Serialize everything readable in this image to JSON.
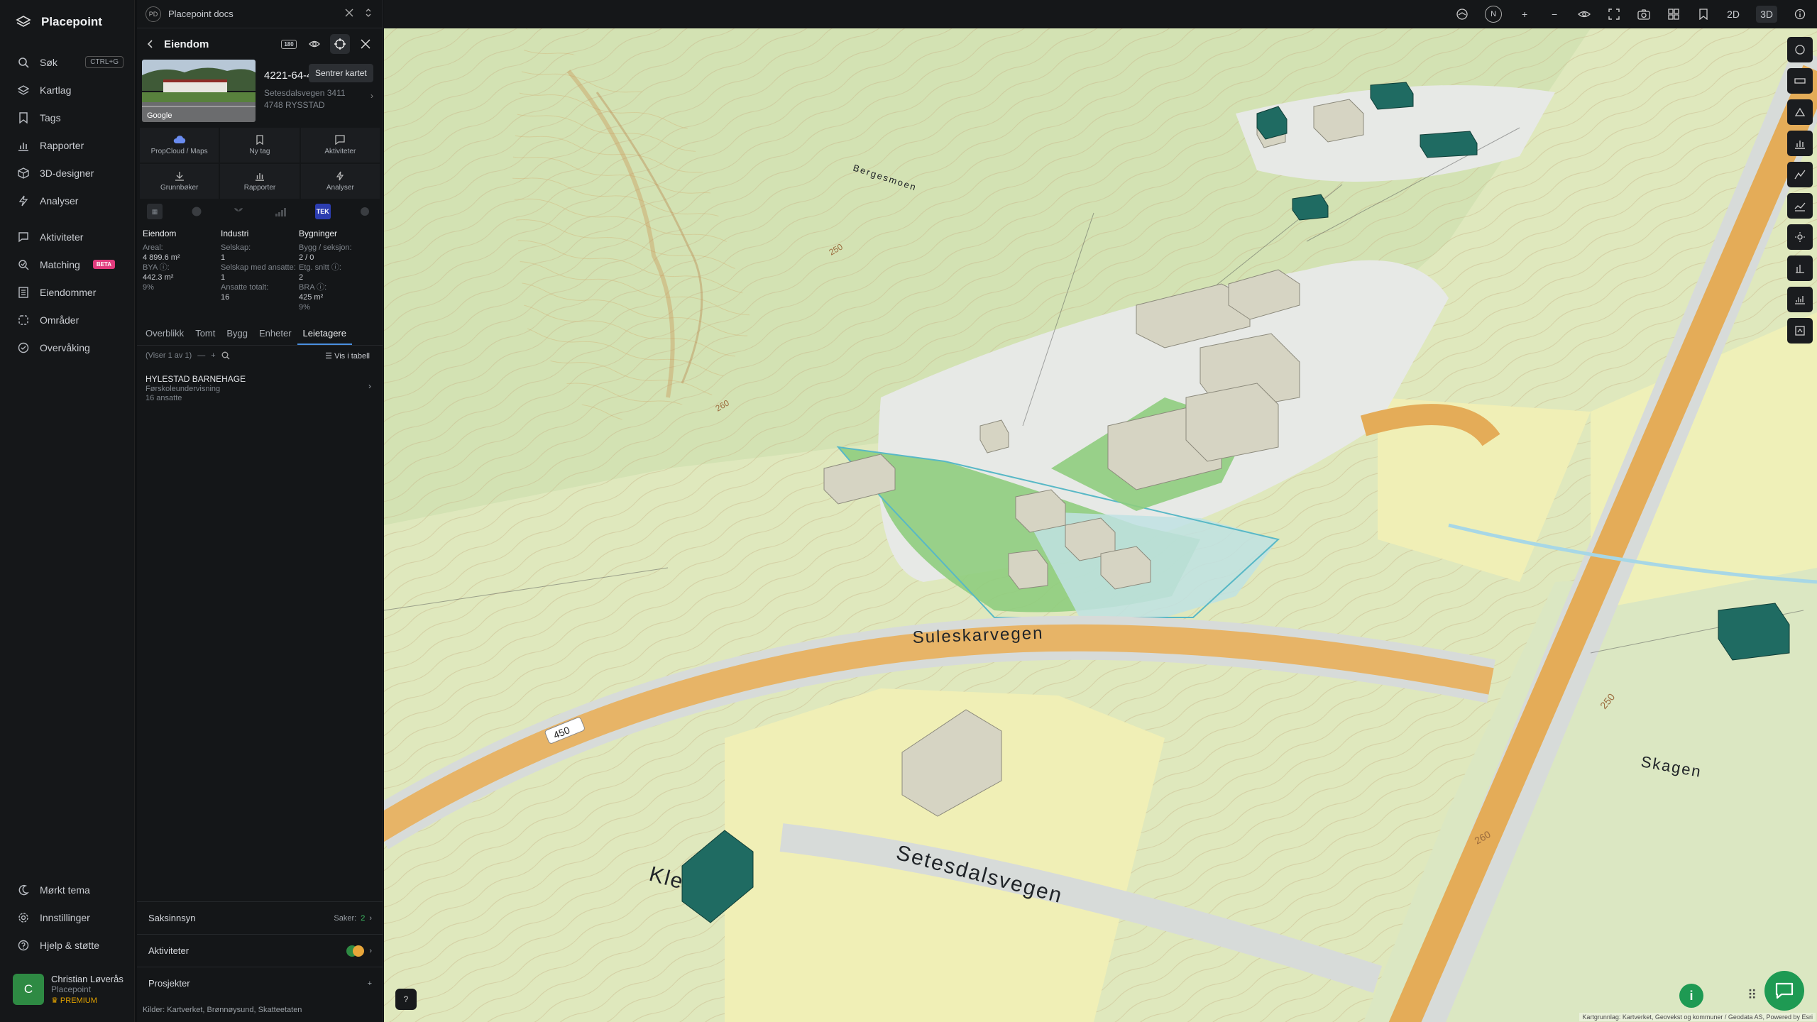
{
  "app": {
    "brand": "Placepoint"
  },
  "nav": {
    "items": [
      {
        "label": "Søk",
        "kbd": "CTRL+G"
      },
      {
        "label": "Kartlag"
      },
      {
        "label": "Tags"
      },
      {
        "label": "Rapporter"
      },
      {
        "label": "3D-designer"
      },
      {
        "label": "Analyser"
      }
    ],
    "items2": [
      {
        "label": "Aktiviteter"
      },
      {
        "label": "Matching",
        "badge": "BETA"
      },
      {
        "label": "Eiendommer"
      },
      {
        "label": "Områder"
      },
      {
        "label": "Overvåking"
      }
    ],
    "bottom": [
      {
        "label": "Mørkt tema"
      },
      {
        "label": "Innstillinger"
      },
      {
        "label": "Hjelp & støtte"
      }
    ]
  },
  "user": {
    "initial": "C",
    "name": "Christian Løverås",
    "org": "Placepoint",
    "plan": "PREMIUM"
  },
  "panel": {
    "doc_title": "Placepoint docs",
    "doc_badge": "PD",
    "header": "Eiendom",
    "header_badge": "180",
    "tooltip": "Sentrer kartet",
    "property": {
      "id": "4221-64-4",
      "address": "Setesdalsvegen 3411",
      "postal": "4748 RYSSTAD",
      "thumb_label": "Google"
    },
    "actions": [
      {
        "label": "PropCloud / Maps"
      },
      {
        "label": "Ny tag"
      },
      {
        "label": "Aktiviteter"
      },
      {
        "label": "Grunnbøker"
      },
      {
        "label": "Rapporter"
      },
      {
        "label": "Analyser"
      }
    ],
    "tek_label": "TEK",
    "stats": {
      "eiendom": {
        "title": "Eiendom",
        "areal_label": "Areal:",
        "areal": "4 899.6 m²",
        "bya_label": "BYA ⓘ:",
        "bya": "442.3 m²",
        "bya_pct": "9%"
      },
      "industri": {
        "title": "Industri",
        "selskap_label": "Selskap:",
        "selskap": "1",
        "ansatte_label": "Selskap med ansatte:",
        "ansatte": "1",
        "ansatte_tot_label": "Ansatte totalt:",
        "ansatte_tot": "16"
      },
      "bygninger": {
        "title": "Bygninger",
        "bygg_label": "Bygg / seksjon:",
        "bygg": "2 / 0",
        "etg_label": "Etg. snitt ⓘ:",
        "etg": "2",
        "bra_label": "BRA ⓘ:",
        "bra": "425 m²",
        "bra_pct": "9%"
      }
    },
    "tabs": [
      "Overblikk",
      "Tomt",
      "Bygg",
      "Enheter",
      "Leietagere"
    ],
    "active_tab": "Leietagere",
    "showing": "(Viser 1 av 1)",
    "show_table": "Vis i tabell",
    "tenant": {
      "name": "HYLESTAD BARNEHAGE",
      "type": "Førskoleundervisning",
      "employees": "16 ansatte"
    },
    "saksinnsyn": {
      "label": "Saksinnsyn",
      "cases_label": "Saker:",
      "cases": "2"
    },
    "aktiviteter": {
      "label": "Aktiviteter"
    },
    "prosjekter": {
      "label": "Prosjekter",
      "action": "+"
    },
    "sources": {
      "label": "Kilder:",
      "items": [
        "Kartverket,",
        "Brønnøysund,",
        "Skatteetaten"
      ]
    }
  },
  "topbar": {
    "compass": "N",
    "mode2d": "2D",
    "mode3d": "3D"
  },
  "map": {
    "labels": {
      "road1": "Suleskarvegen",
      "road2": "Setesdalsvegen",
      "road2_left": "Kle",
      "road_num": "450",
      "place": "Skagen",
      "place2": "Bergesmoen",
      "c1": "260",
      "c2": "250",
      "c3": "260",
      "c4": "250"
    },
    "attribution": "Kartgrunnlag: Kartverket, Geovekst og kommuner / Geodata AS, Powered by Esri",
    "colors": {
      "terrain": "#e2ebc0",
      "forest": "#cfe2b4",
      "road": "#e8b25c",
      "selected_green": "#8ccc7b",
      "selected_blue": "#b9dfe3",
      "building": "#cccbb8",
      "building_dark": "#1f6b62"
    }
  }
}
